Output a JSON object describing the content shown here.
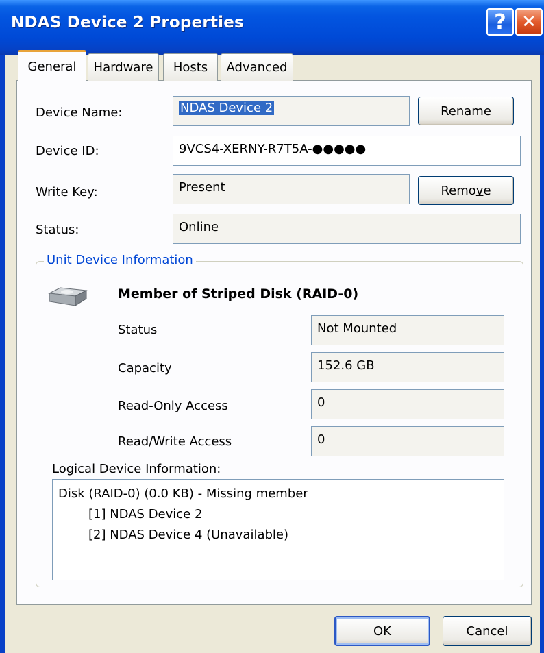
{
  "window": {
    "title": "NDAS Device 2 Properties",
    "help_icon": "?",
    "close_icon": "✕"
  },
  "tabs": [
    {
      "label": "General",
      "active": true
    },
    {
      "label": "Hardware",
      "active": false
    },
    {
      "label": "Hosts",
      "active": false
    },
    {
      "label": "Advanced",
      "active": false
    }
  ],
  "general": {
    "device_name_label": "Device Name:",
    "device_name_value": "NDAS Device 2",
    "rename_button": {
      "pre": "",
      "accel": "R",
      "post": "ename"
    },
    "device_id_label": "Device ID:",
    "device_id_value": "9VCS4-XERNY-R7T5A-●●●●●",
    "write_key_label": "Write Key:",
    "write_key_value": "Present",
    "remove_button": {
      "pre": "Remo",
      "accel": "v",
      "post": "e"
    },
    "status_label": "Status:",
    "status_value": "Online"
  },
  "unit_device": {
    "group_title": "Unit Device Information",
    "icon": "hard-disk-icon",
    "heading": "Member of Striped Disk (RAID-0)",
    "rows": [
      {
        "label": "Status",
        "value": "Not Mounted"
      },
      {
        "label": "Capacity",
        "value": "152.6 GB"
      },
      {
        "label": "Read-Only Access",
        "value": "0"
      },
      {
        "label": "Read/Write Access",
        "value": "0"
      }
    ]
  },
  "logical_device": {
    "label": "Logical Device Information:",
    "items": [
      {
        "text": "Disk (RAID-0) (0.0 KB) - Missing member",
        "indent": 0
      },
      {
        "text": "[1] NDAS Device 2",
        "indent": 1
      },
      {
        "text": "[2] NDAS Device 4 (Unavailable)",
        "indent": 1
      }
    ]
  },
  "footer": {
    "ok_label": "OK",
    "cancel_label": "Cancel"
  },
  "colors": {
    "titlebar": "#0049d6",
    "group_title": "#0046d5",
    "selection": "#316ac5",
    "active_tab_accent": "#e8a33a"
  }
}
